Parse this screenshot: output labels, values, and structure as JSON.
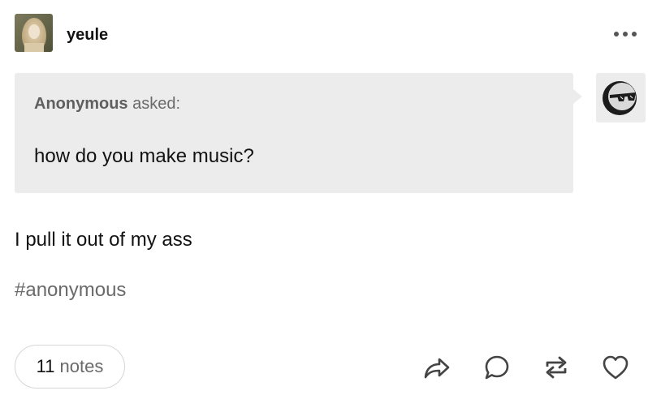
{
  "post": {
    "blog_name": "yeule",
    "ask": {
      "asker": "Anonymous",
      "asked_label": "asked:",
      "question": "how do you make music?"
    },
    "answer": "I pull it out of my ass",
    "tags": [
      "#anonymous"
    ],
    "notes": {
      "count": "11",
      "label": "notes"
    }
  },
  "icons": {
    "avatar": "blog-avatar",
    "more": "more-dots-icon",
    "anon_avatar": "anonymous-sunglasses-icon",
    "share": "share-icon",
    "reply": "reply-icon",
    "reblog": "reblog-icon",
    "like": "heart-icon"
  },
  "colors": {
    "text": "#121212",
    "muted": "#6a6a6a",
    "ask_background": "#ececec",
    "pill_border": "#d6d6d6"
  }
}
